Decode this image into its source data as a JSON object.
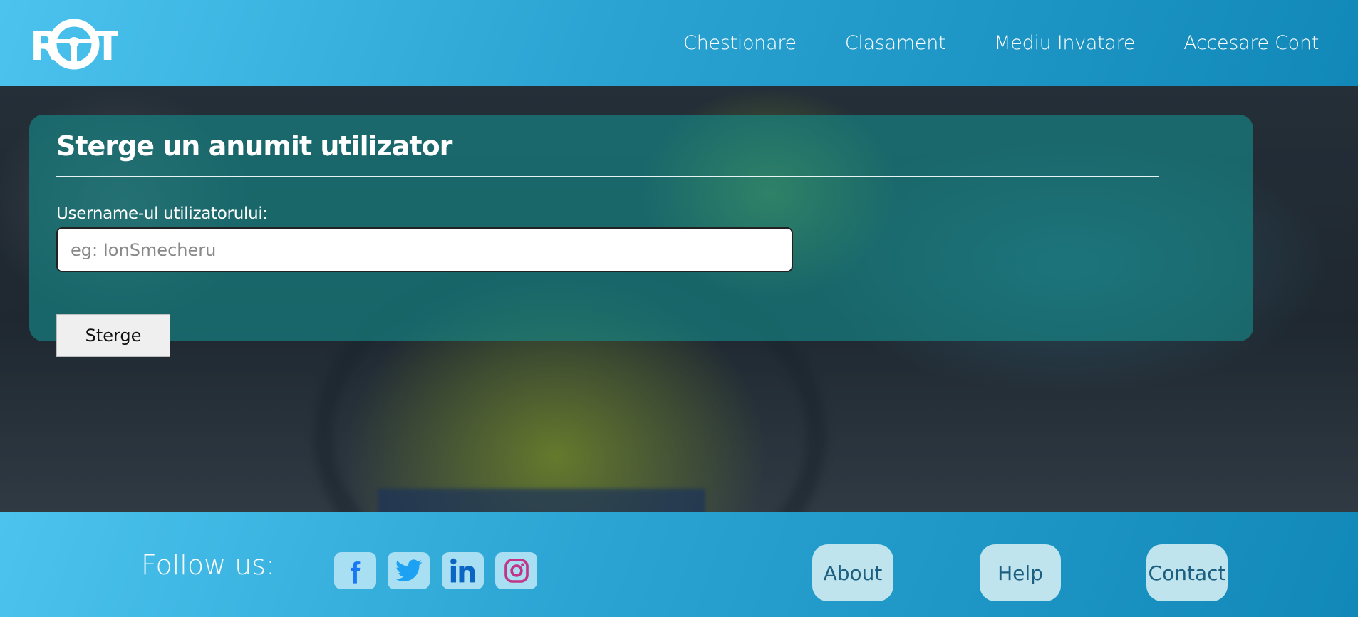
{
  "header": {
    "logo_text": "ROT",
    "nav": [
      {
        "label": "Chestionare"
      },
      {
        "label": "Clasament"
      },
      {
        "label": "Mediu Invatare"
      },
      {
        "label": "Accesare Cont"
      }
    ]
  },
  "panel": {
    "title": "Sterge un anumit utilizator",
    "field_label": "Username-ul utilizatorului:",
    "input_value": "",
    "input_placeholder": "eg: IonSmecheru",
    "submit_label": "Sterge"
  },
  "footer": {
    "follow_label": "Follow us:",
    "social": [
      {
        "icon": "facebook-icon",
        "color": "#1877f2"
      },
      {
        "icon": "twitter-icon",
        "color": "#1da1f2"
      },
      {
        "icon": "linkedin-icon",
        "color": "#0a66c2"
      },
      {
        "icon": "instagram-icon",
        "color": "#c13584"
      }
    ],
    "links": [
      {
        "label": "About"
      },
      {
        "label": "Help"
      },
      {
        "label": "Contact"
      }
    ]
  },
  "colors": {
    "header_gradient_start": "#4cc3ee",
    "header_gradient_end": "#1188b8",
    "panel_bg": "#158c8c",
    "footer_link_bg": "#bfe4ee"
  }
}
